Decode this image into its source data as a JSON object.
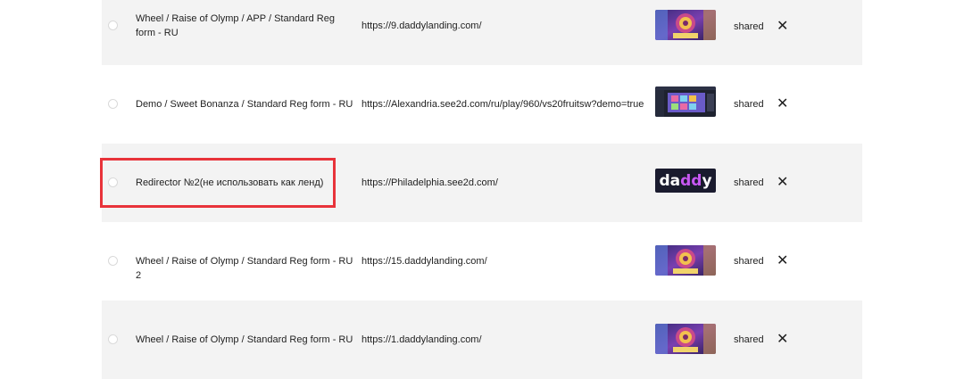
{
  "landings": [
    {
      "name": "Wheel / Raise of Olymp / APP / Standard Reg form - RU",
      "url": "https://9.daddylanding.com/",
      "status": "shared",
      "thumbnail": "olymp-wheel-thumbnail"
    },
    {
      "name": "Demo / Sweet Bonanza / Standard Reg form - RU",
      "url": "https://Alexandria.see2d.com/ru/play/960/vs20fruitsw?demo=true",
      "status": "shared",
      "thumbnail": "slot-screenshot-thumbnail"
    },
    {
      "name": "Redirector №2(не использовать как ленд)",
      "url": "https://Philadelphia.see2d.com/",
      "status": "shared",
      "thumbnail": "daddy-logo-thumbnail",
      "logo_text": "daddy",
      "highlighted": true
    },
    {
      "name": "Wheel / Raise of Olymp / Standard Reg form - RU 2",
      "url": "https://15.daddylanding.com/",
      "status": "shared",
      "thumbnail": "olymp-wheel-thumbnail"
    },
    {
      "name": "Wheel / Raise of Olymp / Standard Reg form - RU",
      "url": "https://1.daddylanding.com/",
      "status": "shared",
      "thumbnail": "olymp-wheel-thumbnail"
    }
  ],
  "colors": {
    "row_alt_bg": "#f3f3f3",
    "highlight_border": "#e8333a",
    "logo_bg": "#1a1b2e",
    "logo_accent": "#c757f2"
  },
  "icons": {
    "remove": "close-icon",
    "select": "radio-icon"
  }
}
